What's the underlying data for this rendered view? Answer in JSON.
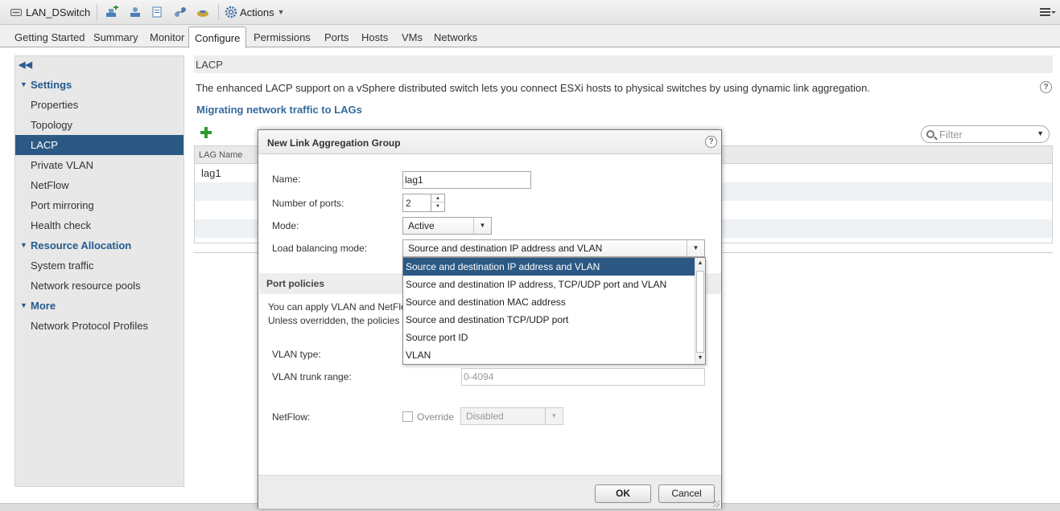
{
  "toolbar": {
    "object_name": "LAN_DSwitch",
    "actions_label": "Actions"
  },
  "tabs": [
    {
      "label": "Getting Started"
    },
    {
      "label": "Summary"
    },
    {
      "label": "Monitor"
    },
    {
      "label": "Configure",
      "active": true
    },
    {
      "label": "Permissions"
    },
    {
      "label": "Ports"
    },
    {
      "label": "Hosts"
    },
    {
      "label": "VMs"
    },
    {
      "label": "Networks"
    }
  ],
  "leftnav": {
    "groups": {
      "settings": "Settings",
      "resource_allocation": "Resource Allocation",
      "more": "More"
    },
    "items": {
      "properties": "Properties",
      "topology": "Topology",
      "lacp": "LACP",
      "private_vlan": "Private VLAN",
      "netflow": "NetFlow",
      "port_mirroring": "Port mirroring",
      "health_check": "Health check",
      "system_traffic": "System traffic",
      "network_resource_pools": "Network resource pools",
      "network_protocol_profiles": "Network Protocol Profiles"
    }
  },
  "main": {
    "title": "LACP",
    "description": "The enhanced LACP support on a vSphere distributed switch lets you connect ESXi hosts to physical switches by using dynamic link aggregation.",
    "link": "Migrating network traffic to LAGs",
    "filter_placeholder": "Filter",
    "grid": {
      "column_lag_name": "LAG Name",
      "rows": [
        "lag1",
        "",
        "",
        ""
      ]
    }
  },
  "dialog": {
    "title": "New Link Aggregation Group",
    "name_label": "Name:",
    "name_value": "lag1",
    "ports_label": "Number of ports:",
    "ports_value": "2",
    "mode_label": "Mode:",
    "mode_value": "Active",
    "lb_label": "Load balancing mode:",
    "lb_value": "Source and destination IP address and VLAN",
    "lb_options": [
      "Source and destination IP address and VLAN",
      "Source and destination IP address, TCP/UDP port and VLAN",
      "Source and destination MAC address",
      "Source and destination TCP/UDP port",
      "Source port ID",
      "VLAN"
    ],
    "port_policies_title": "Port policies",
    "policies_text_1": "You can apply VLAN and NetFlo",
    "policies_text_2": "Unless overridden, the policies",
    "vlan_type_label": "VLAN type:",
    "vlan_trunk_label": "VLAN trunk range:",
    "vlan_trunk_value": "0-4094",
    "netflow_label": "NetFlow:",
    "override_label": "Override",
    "netflow_value": "Disabled",
    "ok_label": "OK",
    "cancel_label": "Cancel"
  },
  "colors": {
    "selection": "#2b5984",
    "link": "#346a9c",
    "add_green": "#2e9a2e"
  }
}
